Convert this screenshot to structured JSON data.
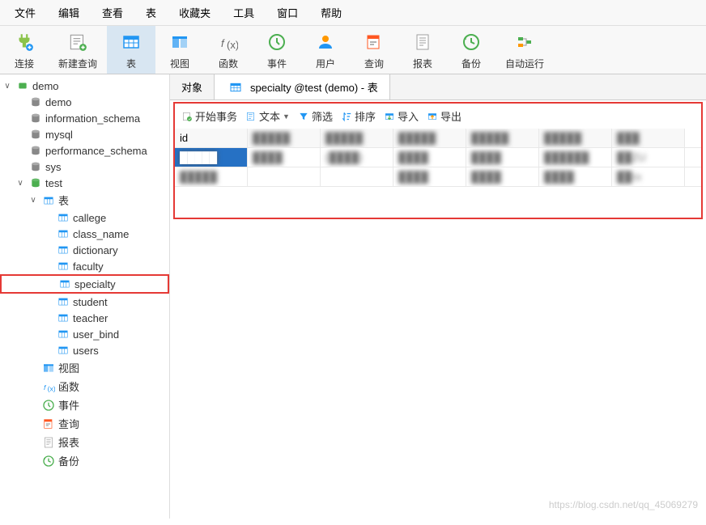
{
  "menu": [
    "文件",
    "编辑",
    "查看",
    "表",
    "收藏夹",
    "工具",
    "窗口",
    "帮助"
  ],
  "toolbar": [
    {
      "label": "连接",
      "icon": "plug-icon",
      "color": "#8bc34a"
    },
    {
      "label": "新建查询",
      "icon": "newquery-icon",
      "color": "#4caf50"
    },
    {
      "label": "表",
      "icon": "table-icon",
      "color": "#2196f3",
      "active": true
    },
    {
      "label": "视图",
      "icon": "view-icon",
      "color": "#2196f3"
    },
    {
      "label": "函数",
      "icon": "function-icon",
      "color": "#666"
    },
    {
      "label": "事件",
      "icon": "event-icon",
      "color": "#4caf50"
    },
    {
      "label": "用户",
      "icon": "user-icon",
      "color": "#ff9800"
    },
    {
      "label": "查询",
      "icon": "query-icon",
      "color": "#ff5722"
    },
    {
      "label": "报表",
      "icon": "report-icon",
      "color": "#9e9e9e"
    },
    {
      "label": "备份",
      "icon": "backup-icon",
      "color": "#4caf50"
    },
    {
      "label": "自动运行",
      "icon": "autorun-icon",
      "color": "#4caf50"
    }
  ],
  "tree": {
    "root": "demo",
    "dbs": [
      "demo",
      "information_schema",
      "mysql",
      "performance_schema",
      "sys",
      "test"
    ],
    "test_node": "test",
    "tables_node": "表",
    "tables": [
      "callege",
      "class_name",
      "dictionary",
      "faculty",
      "specialty",
      "student",
      "teacher",
      "user_bind",
      "users"
    ],
    "others": [
      {
        "label": "视图",
        "icon": "view-icon",
        "color": "#2196f3"
      },
      {
        "label": "函数",
        "icon": "function-icon",
        "color": "#2196f3"
      },
      {
        "label": "事件",
        "icon": "event-icon",
        "color": "#4caf50"
      },
      {
        "label": "查询",
        "icon": "query-icon",
        "color": "#ff5722"
      },
      {
        "label": "报表",
        "icon": "report-icon",
        "color": "#9e9e9e"
      },
      {
        "label": "备份",
        "icon": "backup-icon",
        "color": "#4caf50"
      }
    ],
    "highlighted": "specialty"
  },
  "tabs": [
    {
      "label": "对象",
      "active": false
    },
    {
      "label": "specialty @test (demo) - 表",
      "active": true,
      "icon": "table-icon"
    }
  ],
  "table_toolbar": [
    {
      "label": "开始事务",
      "icon": "tx-icon",
      "color": "#4caf50"
    },
    {
      "label": "文本",
      "icon": "text-icon",
      "color": "#2196f3",
      "dropdown": true
    },
    {
      "label": "筛选",
      "icon": "filter-icon",
      "color": "#2196f3"
    },
    {
      "label": "排序",
      "icon": "sort-icon",
      "color": "#2196f3"
    },
    {
      "label": "导入",
      "icon": "import-icon",
      "color": "#2196f3"
    },
    {
      "label": "导出",
      "icon": "export-icon",
      "color": "#2196f3"
    }
  ],
  "grid": {
    "cols": [
      "id",
      "█████",
      "█████",
      "█████",
      "█████",
      "█████",
      "███"
    ],
    "rows": [
      [
        "█████",
        "████",
        "(████)",
        "████",
        "████",
        "██████",
        "██ZU"
      ],
      [
        "█████",
        "",
        "",
        "████",
        "████",
        "████",
        "██ro"
      ]
    ]
  },
  "watermark": "https://blog.csdn.net/qq_45069279"
}
